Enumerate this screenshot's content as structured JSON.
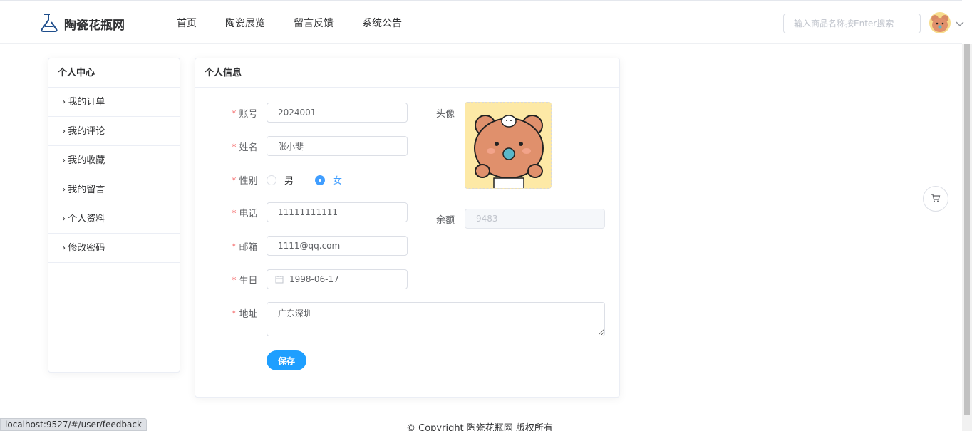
{
  "header": {
    "site_name": "陶瓷花瓶网",
    "nav": [
      "首页",
      "陶瓷展览",
      "留言反馈",
      "系统公告"
    ],
    "search_placeholder": "输入商品名称按Enter搜索"
  },
  "sidebar": {
    "title": "个人中心",
    "items": [
      {
        "label": "我的订单"
      },
      {
        "label": "我的评论"
      },
      {
        "label": "我的收藏"
      },
      {
        "label": "我的留言"
      },
      {
        "label": "个人资料"
      },
      {
        "label": "修改密码"
      }
    ]
  },
  "profile": {
    "title": "个人信息",
    "account_label": "账号",
    "account_value": "2024001",
    "name_label": "姓名",
    "name_value": "张小斐",
    "gender_label": "性别",
    "gender_male": "男",
    "gender_female": "女",
    "gender_selected": "女",
    "phone_label": "电话",
    "phone_value": "11111111111",
    "email_label": "邮箱",
    "email_value": "1111@qq.com",
    "birthday_label": "生日",
    "birthday_value": "1998-06-17",
    "address_label": "地址",
    "address_value": "广东深圳",
    "avatar_label": "头像",
    "balance_label": "余额",
    "balance_value": "9483",
    "save_label": "保存"
  },
  "footer": {
    "copyright": "© Copyright 陶瓷花瓶网 版权所有"
  },
  "status_url": "localhost:9527/#/user/feedback",
  "colors": {
    "primary": "#1e9fff",
    "radio_active": "#409eff",
    "required": "#f56c6c"
  }
}
